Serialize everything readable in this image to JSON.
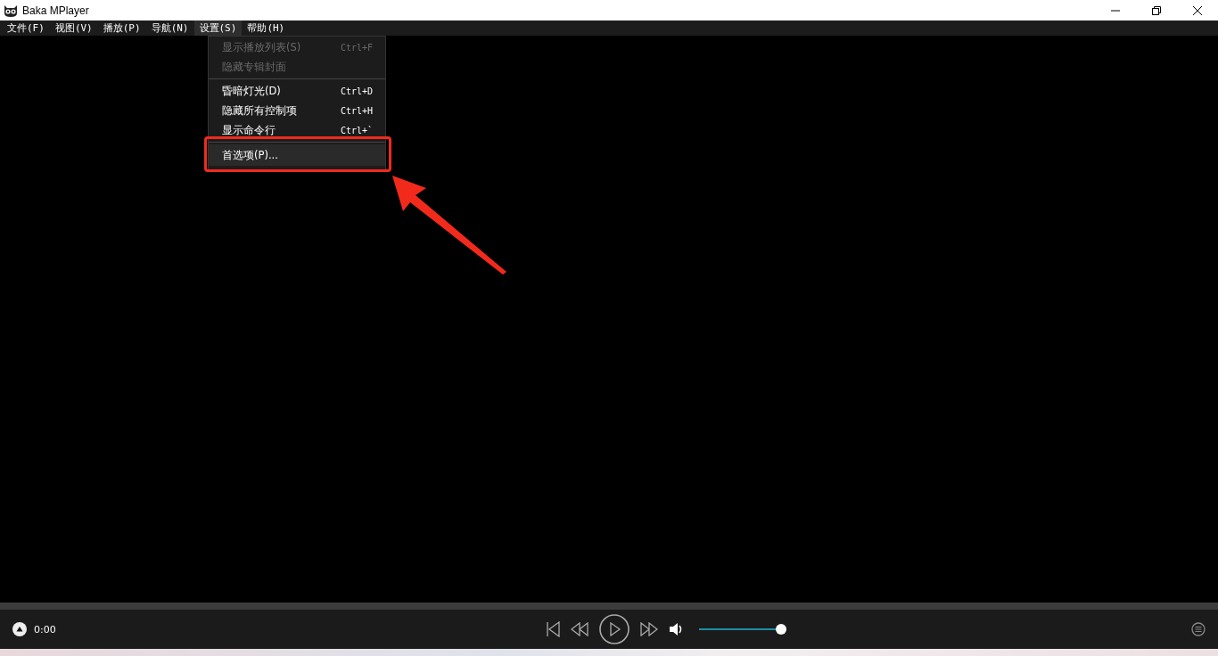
{
  "window": {
    "title": "Baka MPlayer"
  },
  "menubar": [
    {
      "label": "文件(F)",
      "selected": false
    },
    {
      "label": "视图(V)",
      "selected": false
    },
    {
      "label": "播放(P)",
      "selected": false
    },
    {
      "label": "导航(N)",
      "selected": false
    },
    {
      "label": "设置(S)",
      "selected": true
    },
    {
      "label": "帮助(H)",
      "selected": false
    }
  ],
  "dropdown": {
    "items": [
      {
        "label": "显示播放列表(S)",
        "shortcut": "Ctrl+F",
        "disabled": true,
        "selected": false,
        "separator_before": false
      },
      {
        "label": "隐藏专辑封面",
        "disabled": true,
        "selected": false,
        "separator_before": false
      },
      {
        "label": "昏暗灯光(D)",
        "shortcut": "Ctrl+D",
        "disabled": false,
        "selected": false,
        "separator_before": true
      },
      {
        "label": "隐藏所有控制项",
        "shortcut": "Ctrl+H",
        "disabled": false,
        "selected": false,
        "separator_before": false
      },
      {
        "label": "显示命令行",
        "shortcut": "Ctrl+`",
        "disabled": false,
        "selected": false,
        "separator_before": false
      },
      {
        "label": "首选项(P)...",
        "disabled": false,
        "selected": true,
        "separator_before": true
      }
    ]
  },
  "controls": {
    "time": "0:00",
    "volume": {
      "level": 1
    }
  }
}
